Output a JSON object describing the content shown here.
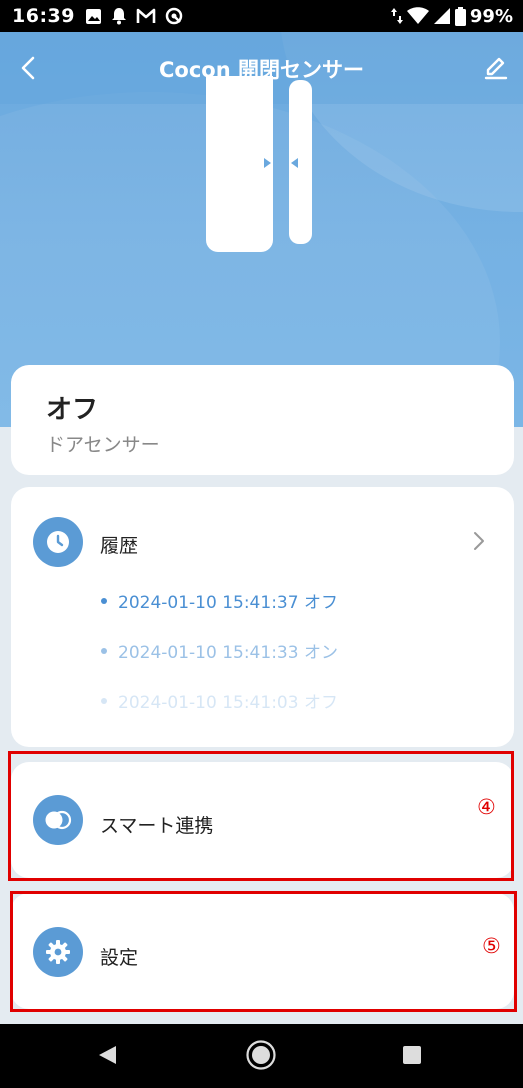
{
  "status_bar": {
    "time": "16:39",
    "battery": "99%",
    "notification_icons": [
      "image-icon",
      "bell-icon",
      "gmail-icon",
      "sync-icon"
    ],
    "system_icons": [
      "data-arrows-icon",
      "wifi-icon",
      "signal-icon",
      "battery-icon"
    ]
  },
  "header": {
    "title": "Cocon 開閉センサー",
    "back_icon": "chevron-left-icon",
    "edit_icon": "pencil-icon",
    "gradient_color": "#6aa8de"
  },
  "status_card": {
    "state": "オフ",
    "device_type": "ドアセンサー"
  },
  "history": {
    "title": "履歴",
    "icon": "clock-icon",
    "entries": [
      "2024-01-10 15:41:37 オフ",
      "2024-01-10 15:41:33 オン",
      "2024-01-10 15:41:03 オフ"
    ],
    "accent_color": "#4a8fd3"
  },
  "smart": {
    "label": "スマート連携",
    "icon": "toggle-icon",
    "annotation": "④"
  },
  "settings": {
    "label": "設定",
    "icon": "gear-icon",
    "annotation": "⑤"
  },
  "annotation_color": "#e00000",
  "nav_bar": {
    "icons": [
      "back-triangle-icon",
      "home-circle-icon",
      "recent-square-icon"
    ]
  }
}
